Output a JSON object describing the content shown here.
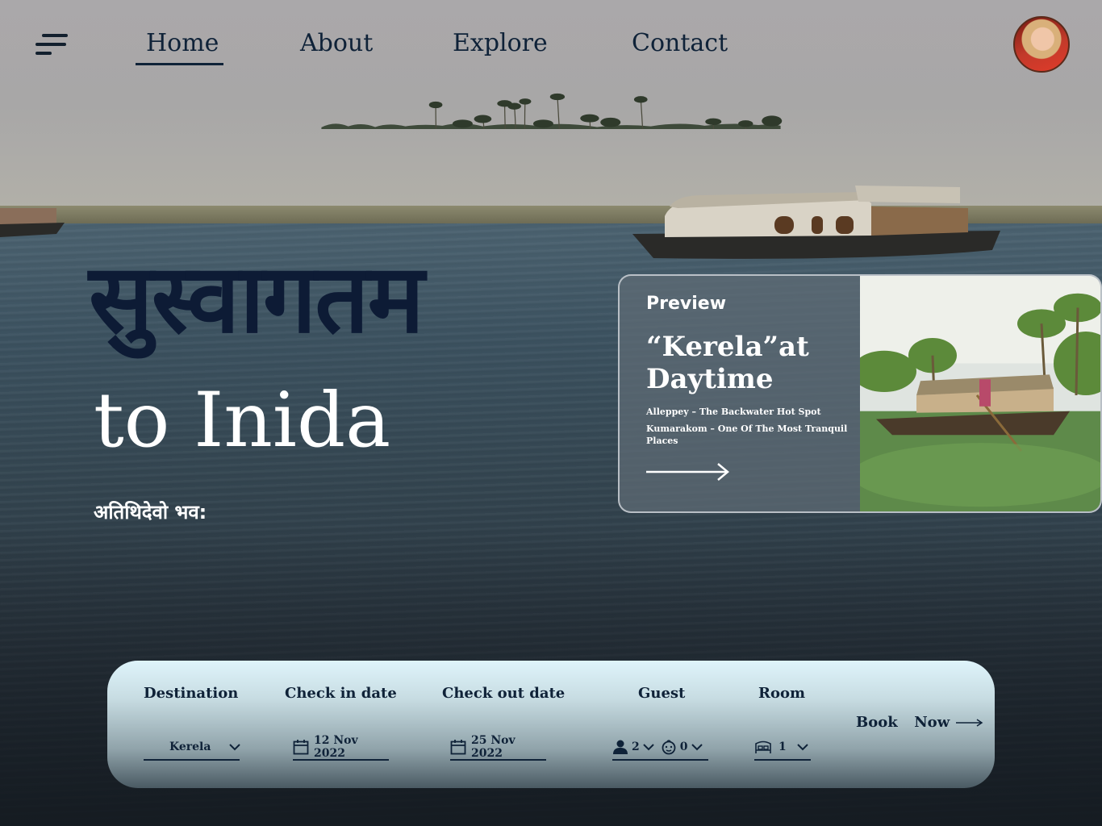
{
  "nav": {
    "links": [
      "Home",
      "About",
      "Explore",
      "Contact"
    ],
    "active": "Home"
  },
  "hero": {
    "devanagari_title": "सुस्वागतम",
    "title": "to Inida",
    "subtitle": "अतिथिदेवो भव:"
  },
  "preview": {
    "label": "Preview",
    "title": "“Kerela”at Daytime",
    "lines": [
      "Alleppey – The Backwater Hot Spot",
      "Kumarakom – One Of The Most Tranquil Places"
    ]
  },
  "booking": {
    "destination": {
      "label": "Destination",
      "value": "Kerela"
    },
    "check_in": {
      "label": "Check in date",
      "value": "12 Nov 2022"
    },
    "check_out": {
      "label": "Check out date",
      "value": "25 Nov 2022"
    },
    "guest": {
      "label": "Guest",
      "adults": "2",
      "children": "0"
    },
    "room": {
      "label": "Room",
      "value": "1"
    },
    "book_now": "Book  Now"
  },
  "colors": {
    "navy": "#0f2238",
    "hero_devanagari": "#0d1b35",
    "card_bg": "#5f6c76"
  },
  "icons": [
    "menu-icon",
    "calendar-icon",
    "person-icon",
    "child-icon",
    "bed-icon",
    "chevron-down-icon",
    "arrow-right-icon"
  ]
}
